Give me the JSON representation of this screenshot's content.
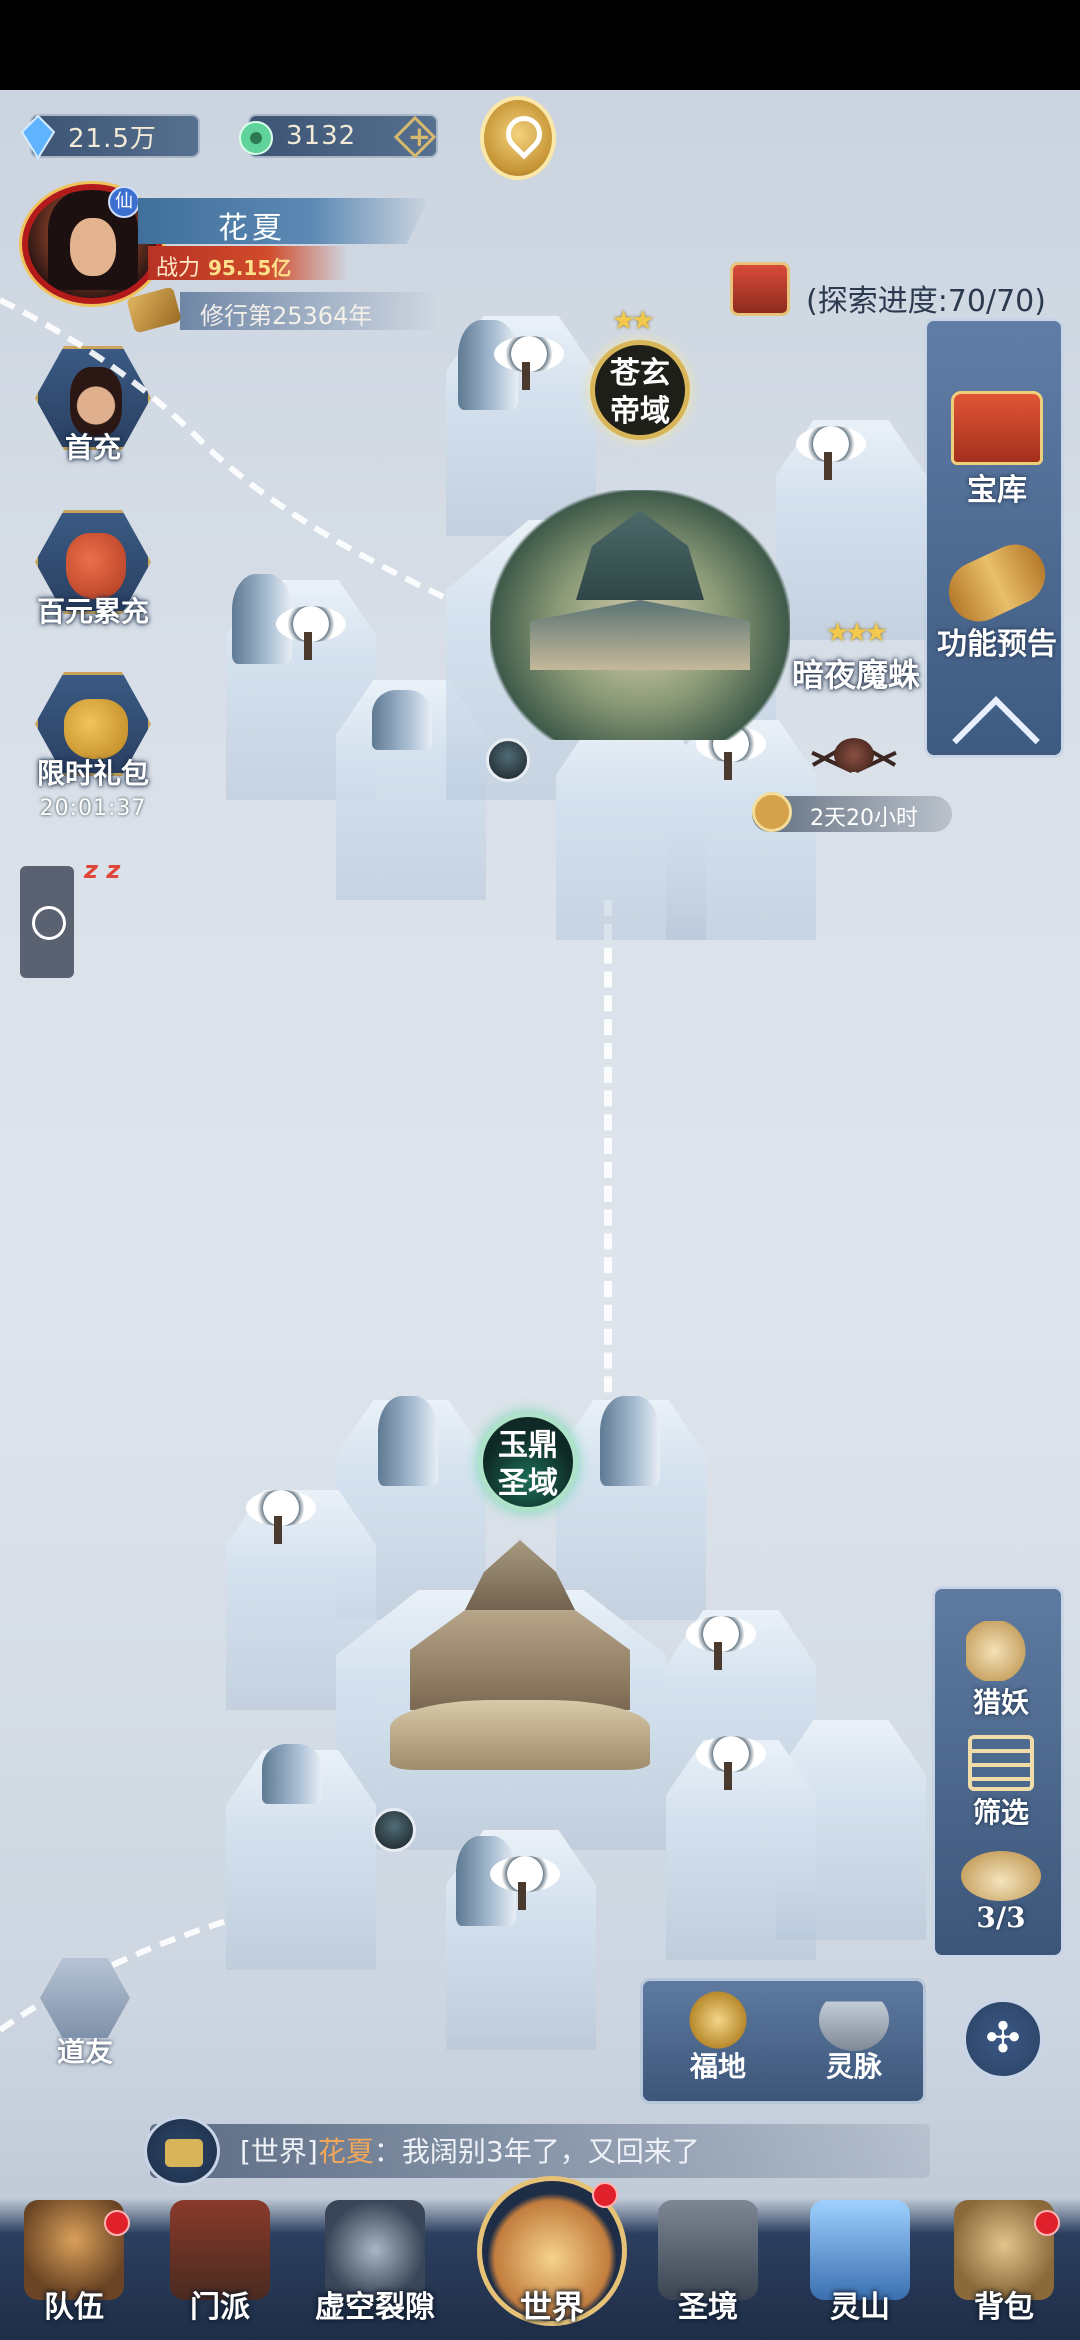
{
  "resources": {
    "diamond": "21.5万",
    "jade": "3132"
  },
  "player": {
    "badge": "仙",
    "name": "花夏",
    "power_label": "战力",
    "power_value": "95.15亿",
    "cultivation": "修行第25364年"
  },
  "left_menu": {
    "first_recharge": "首充",
    "hundred_recharge": "百元累充",
    "limited_pack": "限时礼包",
    "limited_pack_timer": "20:01:37",
    "sleep": "z z"
  },
  "explore": {
    "progress_text": "(探索进度:70/70)"
  },
  "right_menu": {
    "treasury": "宝库",
    "preview": "功能预告"
  },
  "map": {
    "city_top": [
      "苍玄",
      "帝域"
    ],
    "city_top_stars": "★★",
    "city_bottom": [
      "玉鼎",
      "圣域"
    ],
    "boss_name": "暗夜魔蛛",
    "boss_stars": "★★★",
    "boss_timer": "2天20小时"
  },
  "right_menu2": {
    "hunt": "猎妖",
    "filter": "筛选",
    "count": "3/3"
  },
  "land": {
    "fudi": "福地",
    "lingmai": "灵脉"
  },
  "daoyou": "道友",
  "chat": {
    "channel": "[世界]",
    "name": "花夏",
    "message": "：我阔别3年了，又回来了"
  },
  "bottom_nav": {
    "team": "队伍",
    "sect": "门派",
    "rift": "虚空裂隙",
    "world": "世界",
    "holy": "圣境",
    "spirit_mountain": "灵山",
    "bag": "背包"
  },
  "colors": {
    "accent_gold": "#d9b55a",
    "power_red": "#c83a28",
    "notify_red": "#e0202a",
    "chat_name": "#f2a65a"
  }
}
